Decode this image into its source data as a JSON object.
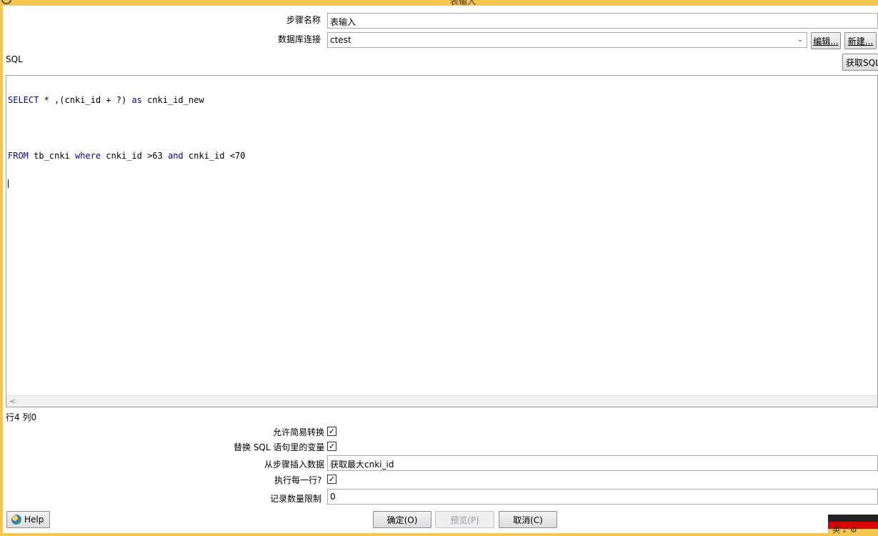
{
  "window": {
    "title": "表输入"
  },
  "form": {
    "step_name_label": "步骤名称",
    "step_name_value": "表输入",
    "db_conn_label": "数据库连接",
    "db_conn_value": "ctest",
    "edit_button": "编辑...",
    "new_button": "新建...",
    "sql_label": "SQL",
    "get_sql_button": "获取SQL"
  },
  "editor": {
    "line1": {
      "kw1": "SELECT",
      "rest1": " * ,(cnki_id + ?) ",
      "kw2": "as",
      "rest2": " cnki_id_new"
    },
    "line2": {
      "kw1": "FROM",
      "rest1": " tb_cnki ",
      "kw2": "where",
      "rest2": " cnki_id >63 ",
      "kw3": "and",
      "rest3": " cnki_id <70"
    },
    "scroll_left_arrow": "<",
    "position_status": "行4 列0"
  },
  "options": {
    "lazy_conversion_label": "允许简易转换",
    "lazy_conversion_checked": true,
    "replace_vars_label": "替换 SQL 语句里的变量",
    "replace_vars_checked": true,
    "insert_from_step_label": "从步骤插入数据",
    "insert_from_step_value": "获取最大cnki_id",
    "execute_each_row_label": "执行每一行?",
    "execute_each_row_checked": true,
    "limit_label": "记录数量限制",
    "limit_value": "0"
  },
  "buttons": {
    "help": "Help",
    "ok": "确定(O)",
    "preview": "预览(P)",
    "cancel": "取消(C)"
  },
  "tray": {
    "text": "英 ♪ ⚙"
  },
  "icons": {
    "help_icon": "help-icon",
    "check_mark": "✓"
  }
}
